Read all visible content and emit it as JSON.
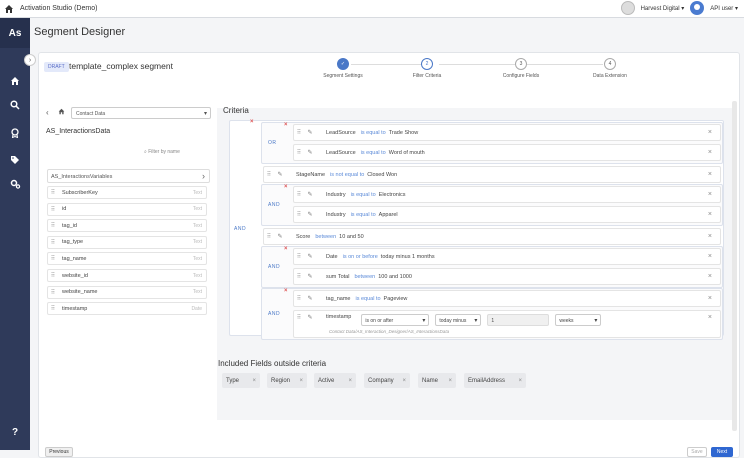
{
  "app": {
    "title": "Activation Studio (Demo)",
    "org": "Harvest Digital",
    "user": "API user"
  },
  "sidebar": {
    "logo": "As",
    "items": [
      {
        "icon": "home-icon"
      },
      {
        "icon": "search-icon"
      },
      {
        "icon": "award-icon"
      },
      {
        "icon": "tag-icon"
      },
      {
        "icon": "gears-icon"
      },
      {
        "icon": "help-icon",
        "label": "?"
      }
    ]
  },
  "page": {
    "title": "Segment Designer"
  },
  "segment": {
    "badge": "DRAFT",
    "name": "template_complex segment"
  },
  "steps": [
    {
      "num": "✓",
      "label": "Segment Settings",
      "state": "done"
    },
    {
      "num": "2",
      "label": "Filter Criteria",
      "state": "current"
    },
    {
      "num": "3",
      "label": "Configure Fields",
      "state": "todo"
    },
    {
      "num": "4",
      "label": "Data Extension",
      "state": "todo"
    }
  ],
  "left": {
    "dropdown": "Contact Data",
    "title": "AS_InteractionsData",
    "filter_placeholder": "Filter by name",
    "group": "AS_InteractionsVariables",
    "fields": [
      {
        "name": "SubscriberKey",
        "type": "Text"
      },
      {
        "name": "id",
        "type": "Text"
      },
      {
        "name": "tag_id",
        "type": "Text"
      },
      {
        "name": "tag_type",
        "type": "Text"
      },
      {
        "name": "tag_name",
        "type": "Text"
      },
      {
        "name": "website_id",
        "type": "Text"
      },
      {
        "name": "website_name",
        "type": "Text"
      },
      {
        "name": "timestamp",
        "type": "Date"
      }
    ]
  },
  "criteria": {
    "title": "Criteria",
    "root_op": "AND",
    "groups": [
      {
        "op": "OR",
        "rows": [
          {
            "field": "LeadSource",
            "operator": "is equal to",
            "value": "Trade Show"
          },
          {
            "field": "LeadSource",
            "operator": "is equal to",
            "value": "Word of mouth"
          }
        ]
      },
      {
        "op": "",
        "rows": [
          {
            "field": "StageName",
            "operator": "is not equal to",
            "value": "Closed Won"
          }
        ]
      },
      {
        "op": "AND",
        "rows": [
          {
            "field": "Industry",
            "operator": "is equal to",
            "value": "Electronics"
          },
          {
            "field": "Industry",
            "operator": "is equal to",
            "value": "Apparel"
          }
        ]
      },
      {
        "op": "",
        "rows": [
          {
            "field": "Score",
            "operator": "between",
            "value": "10 and 50"
          }
        ]
      },
      {
        "op": "AND",
        "rows": [
          {
            "field": "Date",
            "operator": "is on or before",
            "value": "today minus 1 months"
          },
          {
            "field": "sum Total",
            "operator": "between",
            "value": "100 and 1000"
          }
        ]
      },
      {
        "op": "AND",
        "rows": [
          {
            "field": "tag_name",
            "operator": "is equal to",
            "value": "Pageview"
          },
          {
            "field": "timestamp",
            "operator_select": "is on or after",
            "relative_select": "today minus",
            "amount": "1",
            "unit_select": "weeks",
            "path": "Contact Data/AS_Interaction_Designer/AS_InteractionsData"
          }
        ]
      }
    ]
  },
  "included": {
    "title": "Included Fields outside criteria",
    "chips": [
      "Type",
      "Region",
      "Active",
      "Company",
      "Name",
      "EmailAddress"
    ]
  },
  "footer": {
    "previous": "Previous",
    "save": "Save",
    "next": "Next"
  }
}
